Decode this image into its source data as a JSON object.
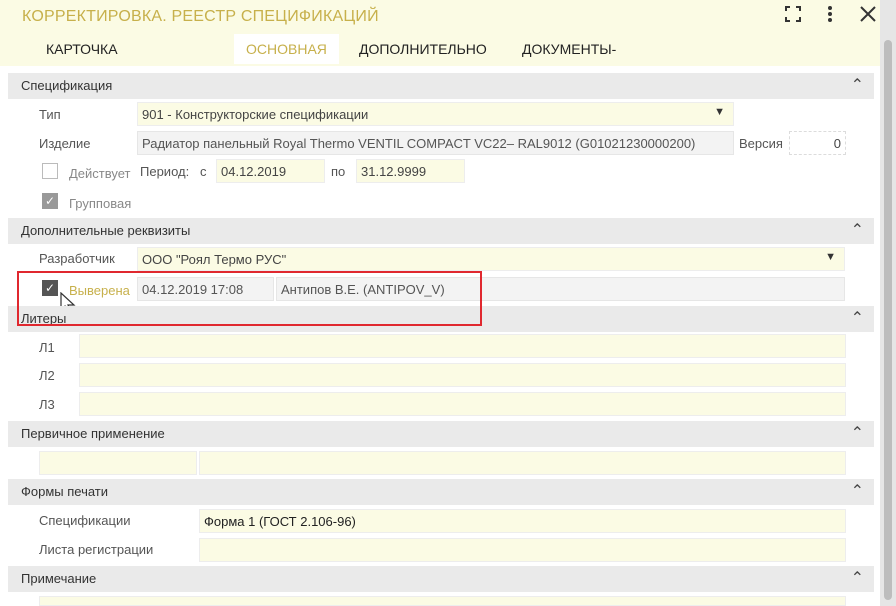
{
  "window": {
    "title": "КОРРЕКТИРОВКА. РЕЕСТР СПЕЦИФИКАЦИЙ",
    "icons": {
      "expand": "fullscreen-icon",
      "menu": "more-vert-icon",
      "close": "close-icon"
    }
  },
  "tabs": [
    {
      "label": "КАРТОЧКА ДОКУМЕНТА",
      "active": false
    },
    {
      "label": "ОСНОВНАЯ",
      "active": true
    },
    {
      "label": "ДОПОЛНИТЕЛЬНО",
      "active": false
    },
    {
      "label": "ДОКУМЕНТЫ-ОСНОВАНИЯ",
      "active": false
    }
  ],
  "spec": {
    "header": "Спецификация",
    "type_label": "Тип",
    "type_value": "901 - Конструкторские спецификации",
    "item_label": "Изделие",
    "item_value": "Радиатор панельный Royal Thermo VENTIL COMPACT VC22– RAL9012 (G01021230000200)",
    "version_label": "Версия",
    "version_value": "0",
    "active_label": "Действует",
    "period_label": "Период:",
    "from_label": "с",
    "from_value": "04.12.2019",
    "to_label": "по",
    "to_value": "31.12.9999",
    "group_label": "Групповая"
  },
  "extra": {
    "header": "Дополнительные реквизиты",
    "developer_label": "Разработчик",
    "developer_value": "ООО \"Роял Термо РУС\"",
    "verified_label": "Выверена",
    "verified_date": "04.12.2019 17:08",
    "verified_by": "Антипов В.Е. (ANTIPOV_V)"
  },
  "liters": {
    "header": "Литеры",
    "l1": "Л1",
    "l2": "Л2",
    "l3": "Л3"
  },
  "primary": {
    "header": "Первичное применение"
  },
  "print": {
    "header": "Формы печати",
    "spec_label": "Спецификации",
    "spec_value": "Форма 1 (ГОСТ 2.106-96)",
    "reg_label": "Листа регистрации"
  },
  "note": {
    "header": "Примечание"
  },
  "colors": {
    "accent": "#c7b04b",
    "field_bg": "#fbfbe4",
    "highlight": "#e0282f"
  }
}
